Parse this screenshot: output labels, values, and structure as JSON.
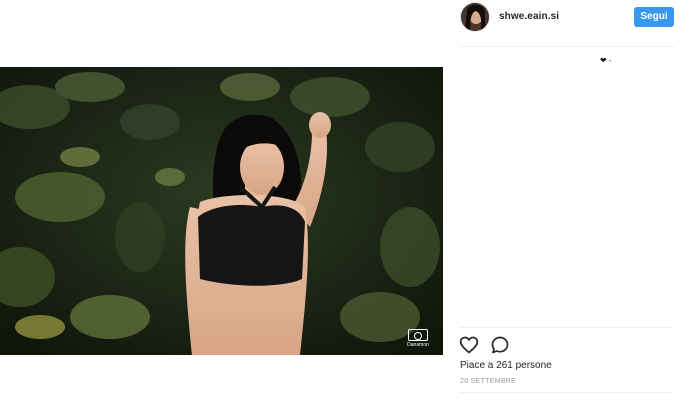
{
  "post": {
    "username": "shwe.eain.si",
    "follow_label": "Segui",
    "caption": "❤ -",
    "likes_text": "Piace a 261 persone",
    "date_text": "20 SETTEMBRE",
    "watermark_text": "Danamon"
  },
  "colors": {
    "follow_button": "#3897f0",
    "text_primary": "#262626",
    "text_secondary": "#999999",
    "divider": "#efefef"
  },
  "icons": {
    "like": "heart-icon",
    "comment": "comment-icon",
    "watermark": "camera-icon"
  }
}
